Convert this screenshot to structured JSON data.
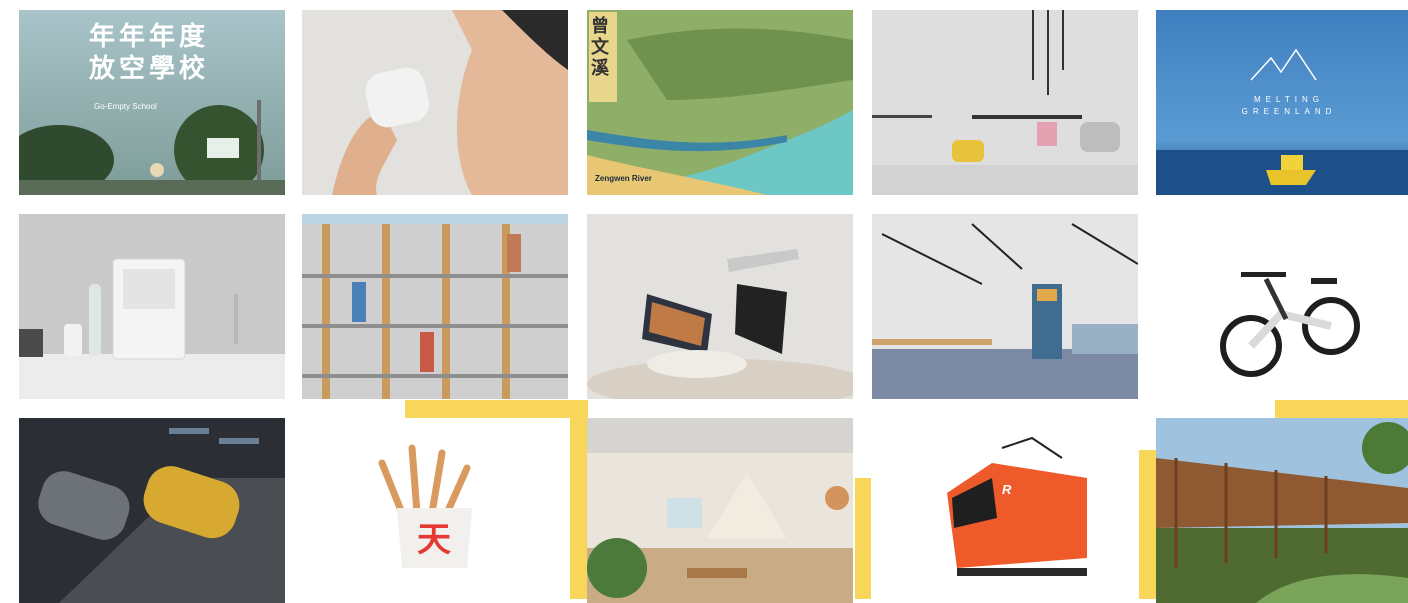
{
  "gallery": {
    "accent_color": "#f7d65a",
    "tiles": [
      {
        "id": "go-empty-school",
        "subject": "Go-Empty School poster",
        "text_lines": [
          "年年年度",
          "放空學校"
        ],
        "sub_text": "Go-Empty School"
      },
      {
        "id": "shaver",
        "subject": "Man shaving with white electric shaver"
      },
      {
        "id": "river-map",
        "subject": "Illustrated river map",
        "title_text": "曾文溪",
        "sub_text": "Zengwen River"
      },
      {
        "id": "furniture",
        "subject": "Chairs, table and stools"
      },
      {
        "id": "melting-greenland",
        "subject": "Glacier and boat",
        "text_lines": [
          "MELTING",
          "GREENLAND"
        ]
      },
      {
        "id": "dish-dryer",
        "subject": "Countertop dish dryer in kitchen"
      },
      {
        "id": "timber-building",
        "subject": "Timber frame apartment facade"
      },
      {
        "id": "laptop-rocks",
        "subject": "Laptops balanced on rocks"
      },
      {
        "id": "office-interior",
        "subject": "Open office interior"
      },
      {
        "id": "e-bike",
        "subject": "White electric bicycle"
      },
      {
        "id": "cars",
        "subject": "Two electric cars from above"
      },
      {
        "id": "fries",
        "subject": "Fried snack in paper sleeve",
        "logo_text": "天"
      },
      {
        "id": "lounge",
        "subject": "Lounge interior with tent"
      },
      {
        "id": "train",
        "subject": "Orange electric locomotive",
        "logo_text": "R"
      },
      {
        "id": "timber-walkway",
        "subject": "Wooden walkway structure in garden"
      }
    ]
  }
}
